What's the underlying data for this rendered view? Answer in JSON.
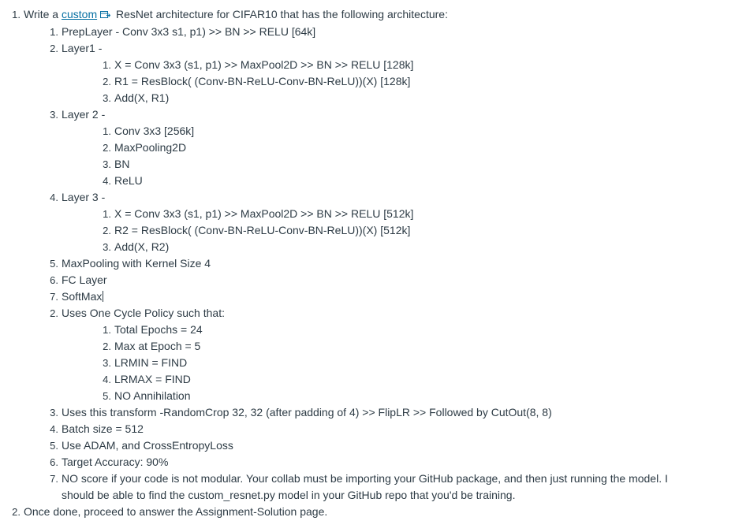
{
  "item1": {
    "number": "1.",
    "prefix": "Write a",
    "link_text": "custom",
    "suffix": "ResNet architecture for CIFAR10 that has the following architecture:",
    "icon": "external-link-icon",
    "accent_color": "#0770a3"
  },
  "arch": [
    {
      "number": "1.",
      "text": "PrepLayer - Conv 3x3 s1, p1) >> BN >> RELU [64k]"
    },
    {
      "number": "2.",
      "text": "Layer1 -",
      "children": [
        {
          "number": "1.",
          "text": "X = Conv 3x3 (s1, p1) >> MaxPool2D >> BN >> RELU [128k]"
        },
        {
          "number": "2.",
          "text": "R1 = ResBlock( (Conv-BN-ReLU-Conv-BN-ReLU))(X) [128k]"
        },
        {
          "number": "3.",
          "text": "Add(X, R1)"
        }
      ]
    },
    {
      "number": "3.",
      "text": "Layer 2 -",
      "children": [
        {
          "number": "1.",
          "text": "Conv 3x3 [256k]"
        },
        {
          "number": "2.",
          "text": "MaxPooling2D"
        },
        {
          "number": "3.",
          "text": "BN"
        },
        {
          "number": "4.",
          "text": "ReLU"
        }
      ]
    },
    {
      "number": "4.",
      "text": "Layer 3 -",
      "children": [
        {
          "number": "1.",
          "text": "X = Conv 3x3 (s1, p1) >> MaxPool2D >> BN >> RELU [512k]"
        },
        {
          "number": "2.",
          "text": "R2 = ResBlock( (Conv-BN-ReLU-Conv-BN-ReLU))(X) [512k]"
        },
        {
          "number": "3.",
          "text": "Add(X, R2)"
        }
      ]
    },
    {
      "number": "5.",
      "text": "MaxPooling with Kernel Size 4"
    },
    {
      "number": "6.",
      "text": "FC Layer"
    },
    {
      "number": "7.",
      "text": "SoftMax"
    }
  ],
  "requirements": [
    {
      "number": "2.",
      "text": "Uses One Cycle Policy such that:",
      "children": [
        {
          "number": "1.",
          "text": "Total Epochs = 24"
        },
        {
          "number": "2.",
          "text": "Max at Epoch = 5"
        },
        {
          "number": "3.",
          "text": "LRMIN = FIND"
        },
        {
          "number": "4.",
          "text": "LRMAX = FIND"
        },
        {
          "number": "5.",
          "text": "NO Annihilation"
        }
      ]
    },
    {
      "number": "3.",
      "text": "Uses this transform -RandomCrop 32, 32 (after padding of 4) >> FlipLR >> Followed by CutOut(8, 8)"
    },
    {
      "number": "4.",
      "text": "Batch size = 512"
    },
    {
      "number": "5.",
      "text": "Use ADAM, and CrossEntropyLoss"
    },
    {
      "number": "6.",
      "text": "Target Accuracy: 90%"
    },
    {
      "number": "7.",
      "text": "NO score if your code is not modular. Your collab must be importing your GitHub package, and then just running the model. I should be able to find the custom_resnet.py model in your GitHub repo that you'd be training."
    }
  ],
  "item2": {
    "number": "2.",
    "text": "Once done, proceed to answer the Assignment-Solution page."
  }
}
